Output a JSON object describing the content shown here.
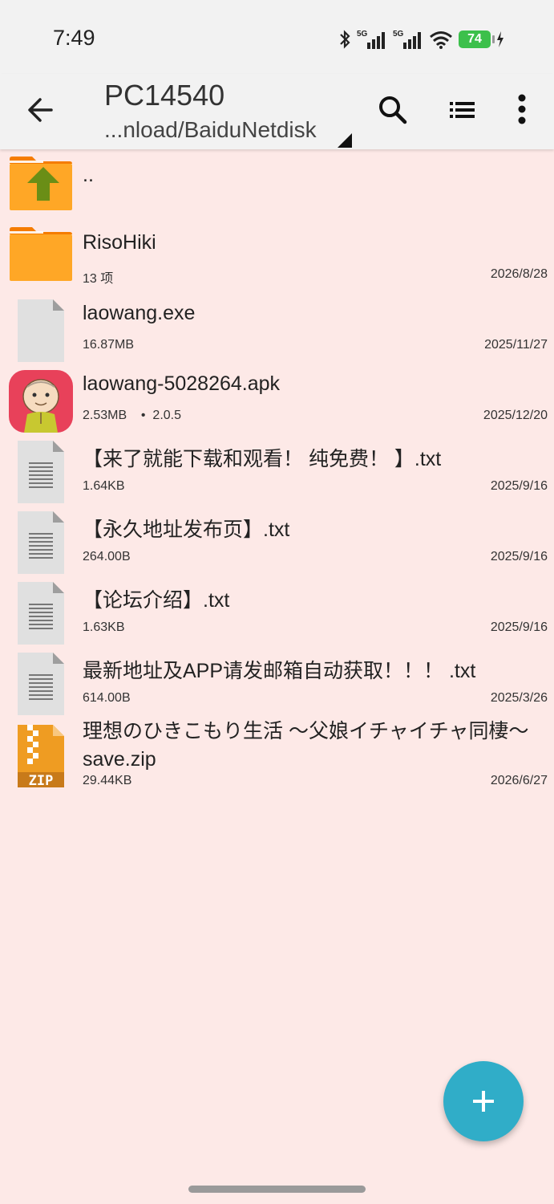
{
  "status_bar": {
    "time": "7:49",
    "signal1_label": "5G",
    "signal2_label": "5G",
    "battery": "74"
  },
  "toolbar": {
    "title": "PC14540",
    "path": "...nload/BaiduNetdisk"
  },
  "files": [
    {
      "name": "..",
      "meta": "",
      "date": "",
      "icon": "folder-up-icon"
    },
    {
      "name": "RisoHiki",
      "meta": "13 项",
      "date": "2026/8/28",
      "icon": "folder-icon"
    },
    {
      "name": "laowang.exe",
      "meta": "16.87MB",
      "date": "2025/11/27",
      "icon": "file-icon"
    },
    {
      "name": "laowang-5028264.apk",
      "meta": "2.53MB    •  2.0.5",
      "date": "2025/12/20",
      "icon": "app-icon"
    },
    {
      "name": "【来了就能下载和观看！ 纯免费！ 】.txt",
      "meta": "1.64KB",
      "date": "2025/9/16",
      "icon": "text-file-icon"
    },
    {
      "name": "【永久地址发布页】.txt",
      "meta": "264.00B",
      "date": "2025/9/16",
      "icon": "text-file-icon"
    },
    {
      "name": "【论坛介绍】.txt",
      "meta": "1.63KB",
      "date": "2025/9/16",
      "icon": "text-file-icon"
    },
    {
      "name": "最新地址及APP请发邮箱自动获取！！！ .txt",
      "meta": "614.00B",
      "date": "2025/3/26",
      "icon": "text-file-icon"
    },
    {
      "name": "理想のひきこもり生活 ～父娘イチャイチャ同棲～save.zip",
      "meta": "29.44KB",
      "date": "2026/6/27",
      "icon": "zip-icon",
      "zip_label": "ZIP"
    }
  ],
  "colors": {
    "background": "#fde9e7",
    "folder": "#ffa726",
    "fab": "#30adc8",
    "battery": "#3cc04b"
  }
}
